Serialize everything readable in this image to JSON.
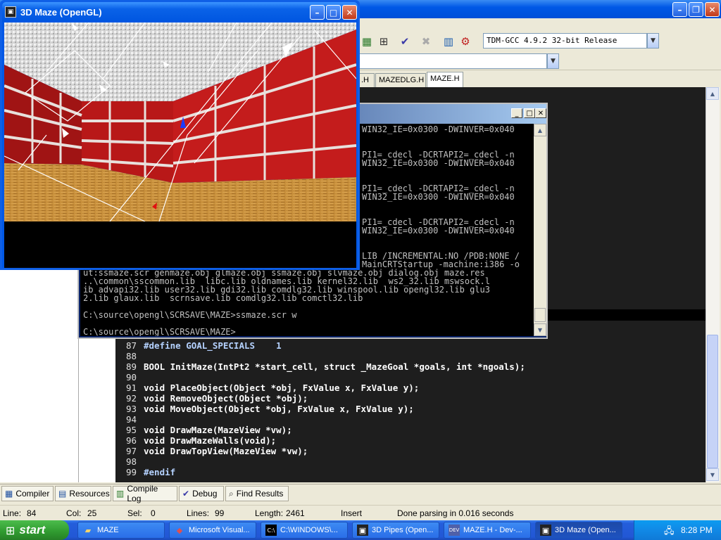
{
  "ide": {
    "compiler_select": "TDM-GCC 4.9.2 32-bit Release",
    "file_tabs": [
      ".H",
      "MAZEDLG.H",
      "MAZE.H"
    ],
    "code_lines": [
      {
        "num": "87",
        "text": "#define GOAL_SPECIALS    1"
      },
      {
        "num": "88",
        "text": ""
      },
      {
        "num": "89",
        "text": "BOOL InitMaze(IntPt2 *start_cell, struct _MazeGoal *goals, int *ngoals);"
      },
      {
        "num": "90",
        "text": ""
      },
      {
        "num": "91",
        "text": "void PlaceObject(Object *obj, FxValue x, FxValue y);"
      },
      {
        "num": "92",
        "text": "void RemoveObject(Object *obj);"
      },
      {
        "num": "93",
        "text": "void MoveObject(Object *obj, FxValue x, FxValue y);"
      },
      {
        "num": "94",
        "text": ""
      },
      {
        "num": "95",
        "text": "void DrawMaze(MazeView *vw);"
      },
      {
        "num": "96",
        "text": "void DrawMazeWalls(void);"
      },
      {
        "num": "97",
        "text": "void DrawTopView(MazeView *vw);"
      },
      {
        "num": "98",
        "text": ""
      },
      {
        "num": "99",
        "text": "#endif"
      }
    ],
    "bottom_tabs": [
      "Compiler",
      "Resources",
      "Compile Log",
      "Debug",
      "Find Results"
    ],
    "status": {
      "line_label": "Line:",
      "line_value": "84",
      "col_label": "Col:",
      "col_value": "25",
      "sel_label": "Sel:",
      "sel_value": "0",
      "lines_label": "Lines:",
      "lines_value": "99",
      "length_label": "Length:",
      "length_value": "2461",
      "mode": "Insert",
      "message": "Done parsing in 0.016 seconds"
    }
  },
  "console": {
    "lines": [
      "WIN32_IE=0x0300 -DWINVER=0x040",
      "",
      "",
      "PI1=_cdecl -DCRTAPI2=_cdecl -n",
      "WIN32_IE=0x0300 -DWINVER=0x040",
      "",
      "",
      "PI1=_cdecl -DCRTAPI2=_cdecl -n",
      "WIN32_IE=0x0300 -DWINVER=0x040",
      "",
      "",
      "PI1=_cdecl -DCRTAPI2=_cdecl -n",
      "WIN32_IE=0x0300 -DWINVER=0x040",
      "",
      "",
      "LIB /INCREMENTAL:NO /PDB:NONE /",
      "MainCRTStartup -machine:i386 -o",
      "ut:ssmaze.scr genmaze.obj glmaze.obj ssmaze.obj slvmaze.obj dialog.obj maze.res",
      "..\\common\\sscommon.lib  libc.lib oldnames.lib kernel32.lib  ws2_32.lib mswsock.l",
      "ib advapi32.lib user32.lib gdi32.lib comdlg32.lib winspool.lib opengl32.lib glu3",
      "2.lib glaux.lib  scrnsave.lib comdlg32.lib comctl32.lib",
      "",
      "C:\\source\\opengl\\SCRSAVE\\MAZE>ssmaze.scr w",
      "",
      "C:\\source\\opengl\\SCRSAVE\\MAZE>"
    ]
  },
  "maze_window": {
    "title": "3D Maze (OpenGL)"
  },
  "taskbar": {
    "start_label": "start",
    "tasks": [
      {
        "label": "MAZE",
        "icon": "folder-icon"
      },
      {
        "label": "Microsoft Visual...",
        "icon": "visual-studio-icon"
      },
      {
        "label": "C:\\WINDOWS\\...",
        "icon": "cmd-icon"
      },
      {
        "label": "3D Pipes (Open...",
        "icon": "pipes-icon"
      },
      {
        "label": "MAZE.H - Dev-...",
        "icon": "devcpp-icon"
      },
      {
        "label": "3D Maze (Open...",
        "icon": "maze-icon"
      }
    ],
    "clock": "8:28 PM"
  },
  "colors": {
    "xp_blue": "#0058e6",
    "editor_bg": "#1e1e1e",
    "console_bg": "#000000",
    "brick": "#b81818",
    "floor": "#c8903c"
  }
}
